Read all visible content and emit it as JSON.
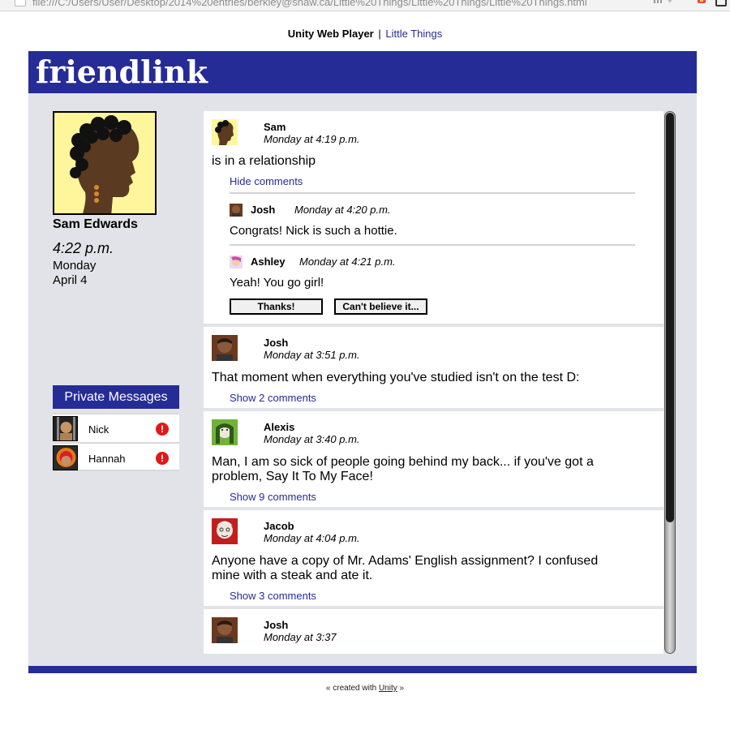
{
  "browser": {
    "url": "file:///C:/Users/User/Desktop/2014%20entries/berkley@shaw.ca/Little%20Things/Little%20Things/Little%20Things.html"
  },
  "page": {
    "player_label": "Unity Web Player",
    "separator": "|",
    "game_title": "Little Things"
  },
  "app": {
    "logo": "friendlink",
    "accent_color": "#262c96"
  },
  "profile": {
    "name": "Sam Edwards",
    "time": "4:22 p.m.",
    "day": "Monday",
    "date": "April 4"
  },
  "private_messages": {
    "title": "Private Messages",
    "items": [
      {
        "name": "Nick",
        "alert": "!"
      },
      {
        "name": "Hannah",
        "alert": "!"
      }
    ]
  },
  "posts": [
    {
      "author": "Sam",
      "time": "Monday at 4:19 p.m.",
      "text": "is in a relationship",
      "link": "Hide comments",
      "comments": [
        {
          "author": "Josh",
          "time": "Monday at 4:20 p.m.",
          "text": "Congrats! Nick is such a hottie."
        },
        {
          "author": "Ashley",
          "time": "Monday at 4:21 p.m.",
          "text": "Yeah! You go girl!"
        }
      ],
      "buttons": [
        "Thanks!",
        "Can't believe it..."
      ]
    },
    {
      "author": "Josh",
      "time": "Monday at 3:51 p.m.",
      "text": "That moment when everything you've studied isn't on the test D:",
      "link": "Show 2 comments"
    },
    {
      "author": "Alexis",
      "time": "Monday at 3:40 p.m.",
      "text_line1": "Man, I am so sick of people going behind my back... if you've got a",
      "text_line2": "problem, Say It To My Face!",
      "link": "Show 9 comments"
    },
    {
      "author": "Jacob",
      "time": "Monday at 4:04 p.m.",
      "text_line1": "Anyone have a copy of Mr. Adams' English assignment? I confused",
      "text_line2": "mine with a steak and ate it.",
      "link": "Show 3 comments"
    },
    {
      "author": "Josh",
      "time": "Monday at 3:37"
    }
  ],
  "footer": {
    "prefix": "« created with",
    "link": "Unity",
    "suffix": "»"
  }
}
